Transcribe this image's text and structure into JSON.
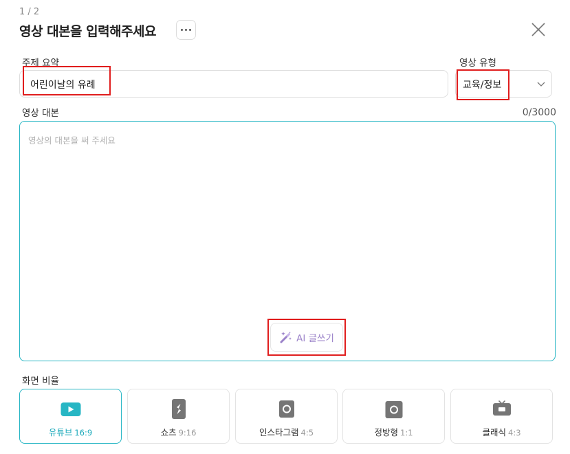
{
  "header": {
    "step": "1 / 2",
    "title": "영상 대본을 입력해주세요"
  },
  "topic": {
    "label": "주제 요약",
    "value": "어린이날의 유례"
  },
  "video_type": {
    "label": "영상 유형",
    "value": "교육/정보"
  },
  "script": {
    "label": "영상 대본",
    "counter": "0/3000",
    "placeholder": "영상의 대본을 써 주세요",
    "ai_button_label": "AI 글쓰기"
  },
  "ratio": {
    "label": "화면 비율",
    "options": [
      {
        "name": "유튜브",
        "ratio": "16:9",
        "icon": "youtube-icon",
        "selected": true
      },
      {
        "name": "쇼츠",
        "ratio": "9:16",
        "icon": "shorts-icon",
        "selected": false
      },
      {
        "name": "인스타그램",
        "ratio": "4:5",
        "icon": "instagram-icon",
        "selected": false
      },
      {
        "name": "정방형",
        "ratio": "1:1",
        "icon": "square-icon",
        "selected": false
      },
      {
        "name": "클래식",
        "ratio": "4:3",
        "icon": "tv-icon",
        "selected": false
      }
    ]
  },
  "colors": {
    "accent": "#27b6c4",
    "highlight": "#e01d1d",
    "ai_text": "#9b82c9"
  }
}
